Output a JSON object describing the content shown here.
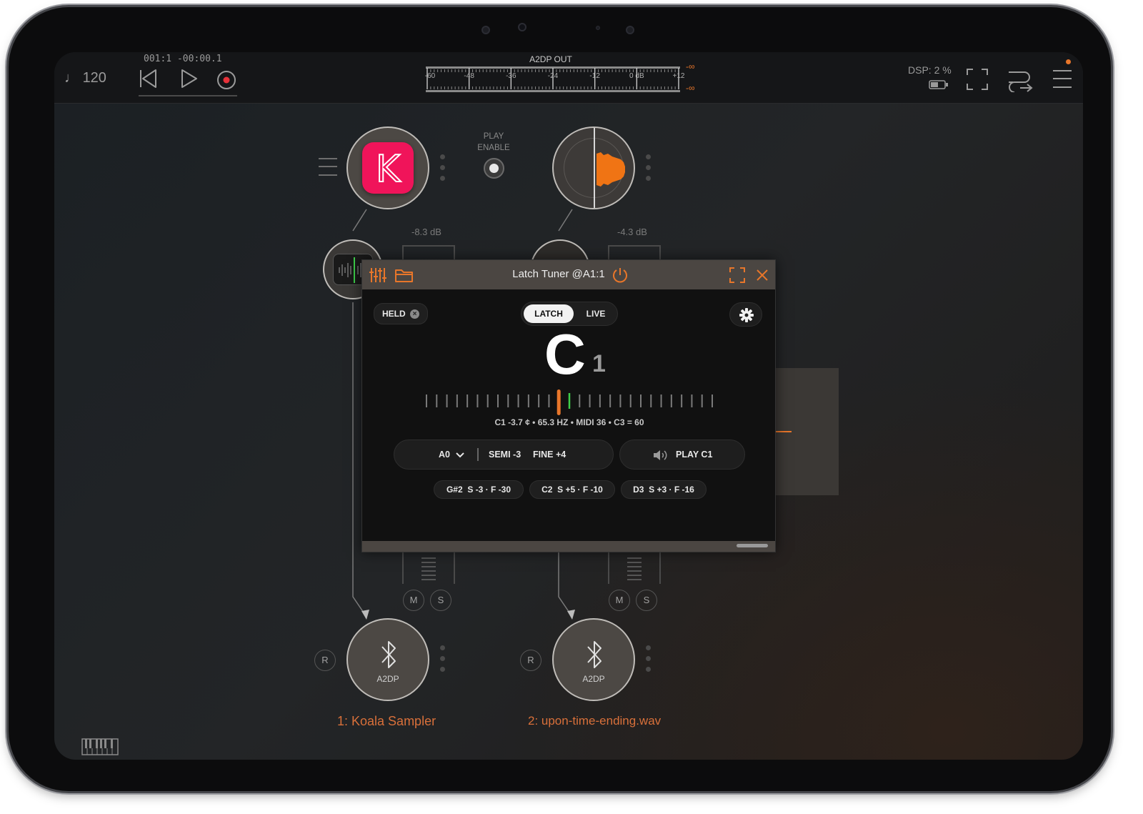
{
  "transport": {
    "tempo": "120",
    "position": "001:1 -00:00.1"
  },
  "meter": {
    "title": "A2DP OUT",
    "scale": [
      "-60",
      "-48",
      "-36",
      "-24",
      "-12",
      "0 dB",
      "+12"
    ],
    "peak_top": "-∞",
    "peak_bottom": "-∞"
  },
  "dsp": {
    "label": "DSP:",
    "value": "2 %"
  },
  "play_enable": {
    "line1": "PLAY",
    "line2": "ENABLE"
  },
  "channels": [
    {
      "gain": "-8.3 dB",
      "mute": "M",
      "solo": "S",
      "record": "R",
      "output": "A2DP",
      "name": "1: Koala Sampler",
      "app_letter": "K"
    },
    {
      "gain": "-4.3 dB",
      "mute": "M",
      "solo": "S",
      "record": "R",
      "output": "A2DP",
      "name": "2: upon-time-ending.wav"
    }
  ],
  "tuner": {
    "title": "Latch Tuner @A1:1",
    "held": "HELD",
    "mode_latch": "LATCH",
    "mode_live": "LIVE",
    "note": "C",
    "octave": "1",
    "readout": "C1 -3.7 ¢ • 65.3 HZ • MIDI 36 • C3 = 60",
    "ref_note": "A0",
    "semi": "SEMI -3",
    "fine": "FINE +4",
    "play": "PLAY C1",
    "presets": [
      {
        "note": "G#2",
        "detail": "S -3 · F -30"
      },
      {
        "note": "C2",
        "detail": "S +5 · F -10"
      },
      {
        "note": "D3",
        "detail": "S +3 · F -16"
      }
    ],
    "cents": -3.7
  },
  "colors": {
    "accent": "#e8762a",
    "app_pink": "#f0145a",
    "tuner_green": "#3ecf4a",
    "label_orange": "#d9703a"
  },
  "icons": [
    "metronome-note-icon",
    "rewind-icon",
    "play-icon",
    "record-icon",
    "battery-icon",
    "fullscreen-icon",
    "routing-icon",
    "menu-icon",
    "bluetooth-icon",
    "mixer-icon",
    "folder-icon",
    "power-icon",
    "close-icon",
    "gear-icon",
    "speaker-icon",
    "chevron-down-icon",
    "piano-keyboard-icon"
  ]
}
